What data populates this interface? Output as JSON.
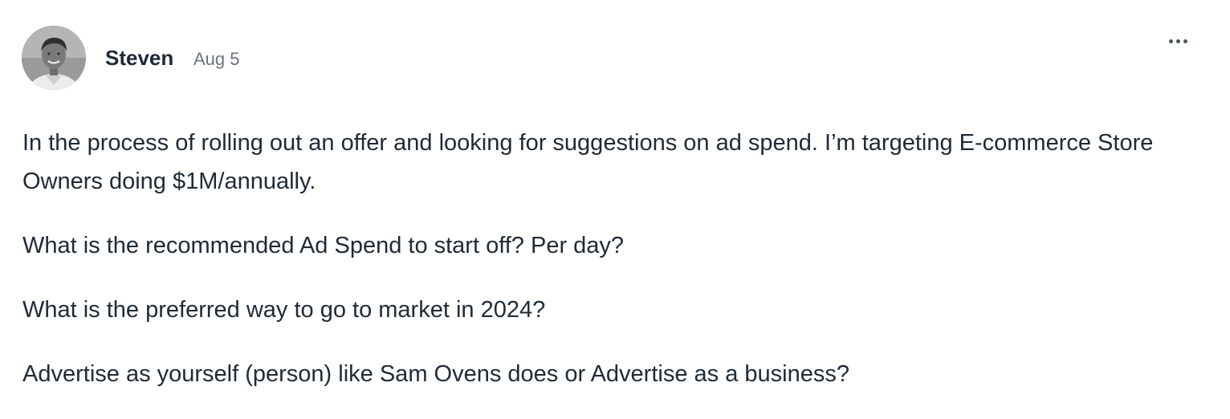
{
  "post": {
    "author": "Steven",
    "date": "Aug 5",
    "menu_icon": "more-horizontal-icon",
    "paragraphs": [
      "In the process of rolling out an offer and looking for suggestions on ad spend. I’m targeting E-commerce Store Owners doing $1M/annually.",
      "What is the recommended Ad Spend to start off? Per day?",
      "What is the preferred way to go to market in 2024?",
      "Advertise as yourself (person) like Sam Ovens does or Advertise as a business?"
    ]
  }
}
